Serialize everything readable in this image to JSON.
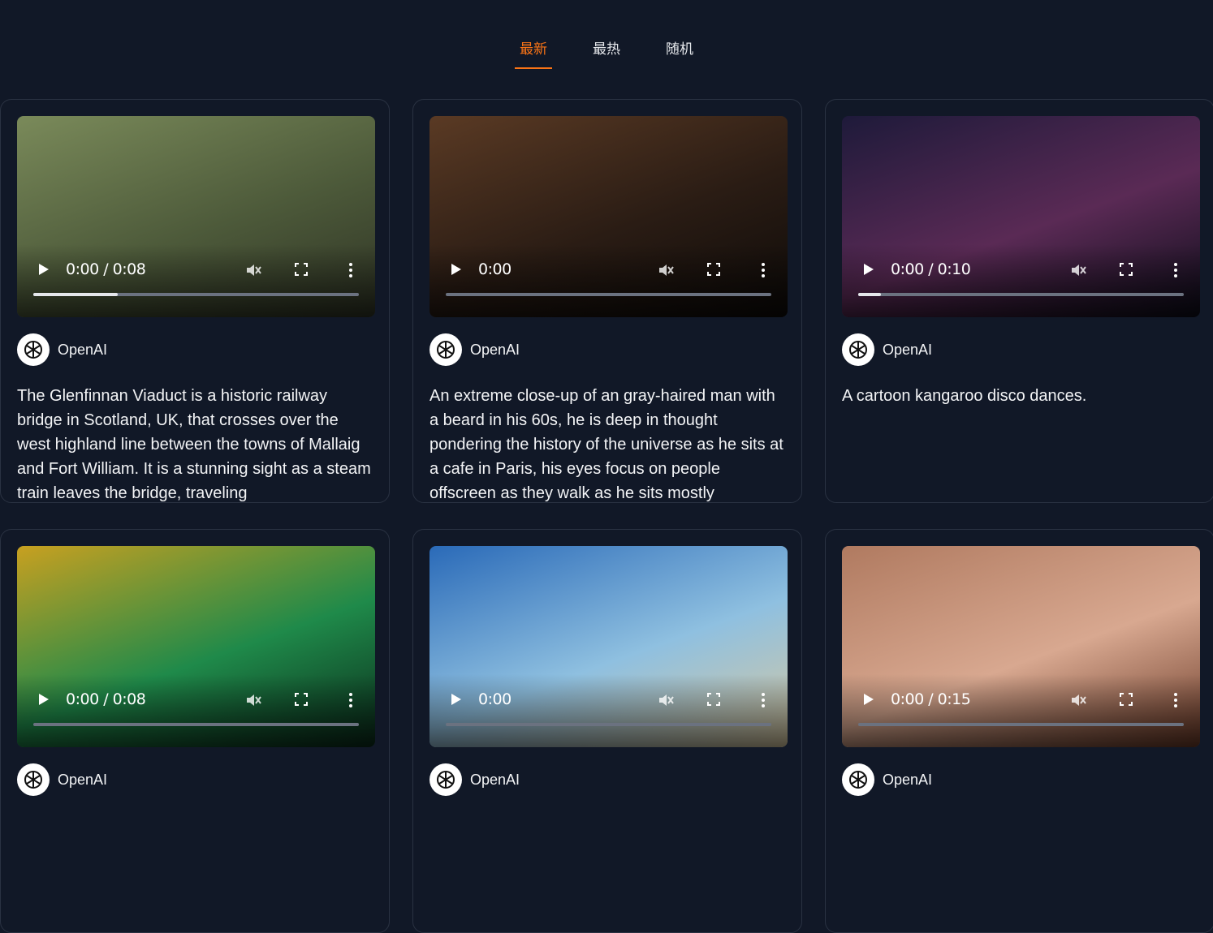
{
  "tabs": [
    {
      "label": "最新",
      "active": true
    },
    {
      "label": "最热",
      "active": false
    },
    {
      "label": "随机",
      "active": false
    }
  ],
  "cards": [
    {
      "time": "0:00 / 0:08",
      "progress": 0.26,
      "author": "OpenAI",
      "description": "The Glenfinnan Viaduct is a historic railway bridge in Scotland, UK, that crosses over the west highland line between the towns of Mallaig and Fort William. It is a stunning sight as a steam train leaves the bridge, traveling",
      "thumb_colors": [
        "#7a8a5a",
        "#4d5a3a",
        "#2e3324"
      ]
    },
    {
      "time": "0:00",
      "progress": 0,
      "author": "OpenAI",
      "description": "An extreme close-up of an gray-haired man with a beard in his 60s, he is deep in thought pondering the history of the universe as he sits at a cafe in Paris, his eyes focus on people offscreen as they walk as he sits mostly",
      "thumb_colors": [
        "#5a3a24",
        "#2a1c14",
        "#0d0a08"
      ]
    },
    {
      "time": "0:00 / 0:10",
      "progress": 0.07,
      "author": "OpenAI",
      "description": "A cartoon kangaroo disco dances.",
      "thumb_colors": [
        "#1e1a3a",
        "#5a2a55",
        "#0c0c18"
      ]
    },
    {
      "time": "0:00 / 0:08",
      "progress": 0,
      "author": "OpenAI",
      "description": "",
      "thumb_colors": [
        "#c8a020",
        "#1f8a4a",
        "#0a2a1a"
      ]
    },
    {
      "time": "0:00",
      "progress": 0,
      "author": "OpenAI",
      "description": "",
      "thumb_colors": [
        "#2a6ab8",
        "#8fc0e0",
        "#d8c8a0"
      ]
    },
    {
      "time": "0:00 / 0:15",
      "progress": 0,
      "author": "OpenAI",
      "description": "",
      "thumb_colors": [
        "#b07a60",
        "#d8a890",
        "#6a3a28"
      ]
    }
  ],
  "colors": {
    "accent": "#f97316",
    "background": "#111827",
    "card_border": "#2a3242"
  }
}
